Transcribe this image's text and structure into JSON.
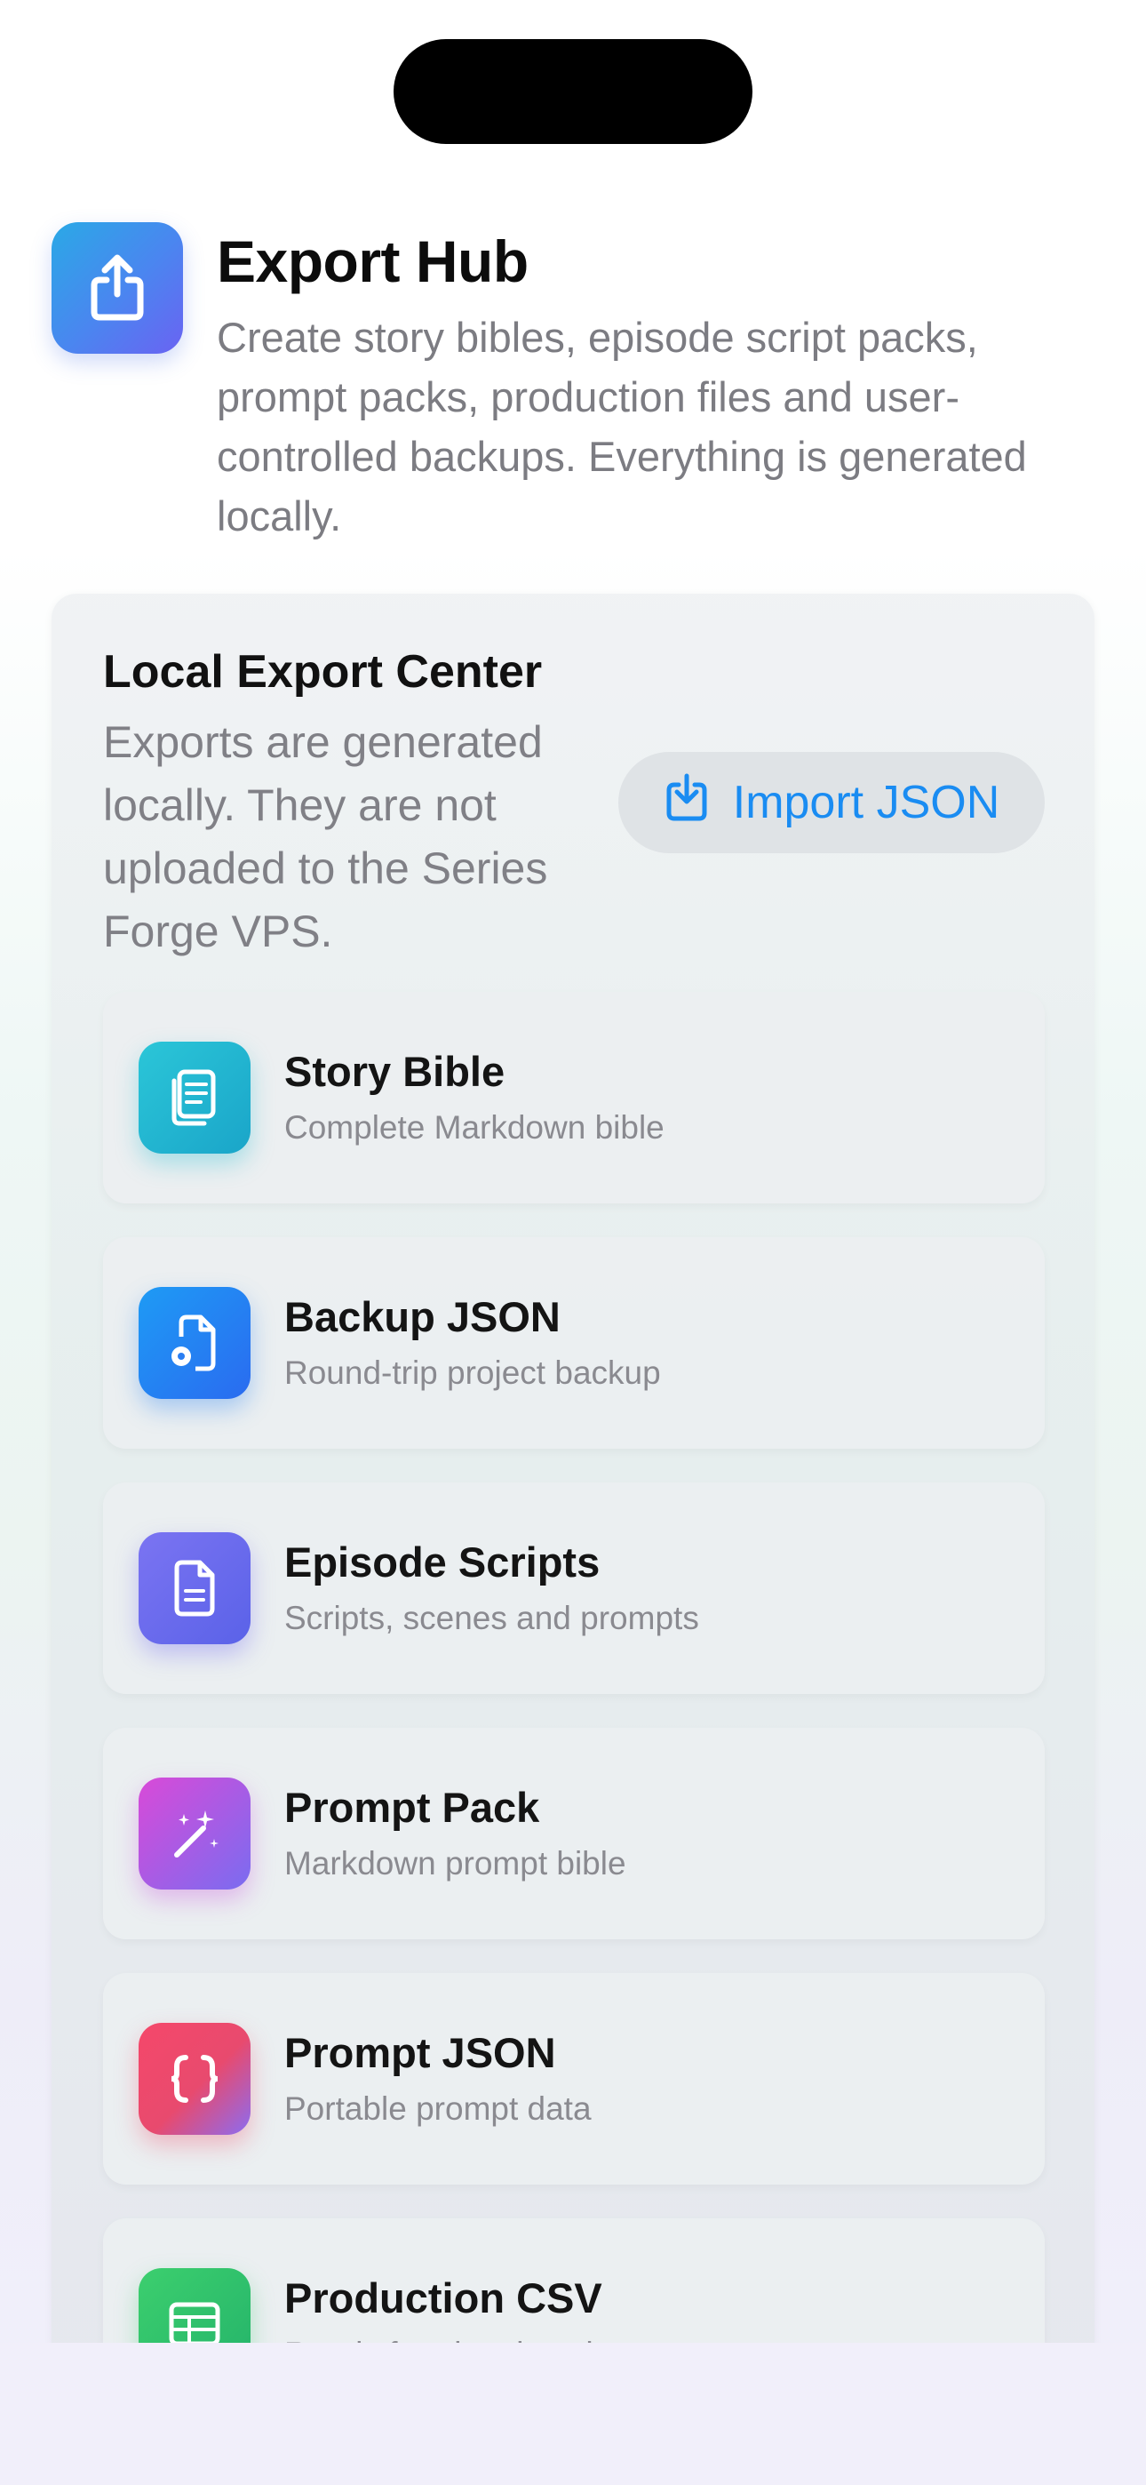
{
  "header": {
    "title": "Export Hub",
    "subtitle": "Create story bibles, episode script packs, prompt packs, production files and user-controlled backups. Everything is generated locally.",
    "icon": "share-icon"
  },
  "panel": {
    "title": "Local Export Center",
    "description": "Exports are generated locally. They are not uploaded to the Series Forge VPS.",
    "import_label": "Import JSON",
    "import_icon": "download-tray-icon"
  },
  "exports": [
    {
      "title": "Story Bible",
      "subtitle": "Complete Markdown bible",
      "icon": "book-pages-icon",
      "colors": [
        "#2bc6d8",
        "#1aa5c9"
      ]
    },
    {
      "title": "Backup JSON",
      "subtitle": "Round-trip project backup",
      "icon": "document-gear-icon",
      "colors": [
        "#1e9bf5",
        "#2a6bf0"
      ]
    },
    {
      "title": "Episode Scripts",
      "subtitle": "Scripts, scenes and prompts",
      "icon": "document-lines-icon",
      "colors": [
        "#7b74f2",
        "#5a62e8"
      ]
    },
    {
      "title": "Prompt Pack",
      "subtitle": "Markdown prompt bible",
      "icon": "magic-wand-icon",
      "colors": [
        "#d94ad8",
        "#7a6cf0"
      ]
    },
    {
      "title": "Prompt JSON",
      "subtitle": "Portable prompt data",
      "icon": "braces-icon",
      "colors": [
        "#f5486a",
        "#8b6cf2"
      ]
    },
    {
      "title": "Production CSV",
      "subtitle": "Ready for planning sheets",
      "icon": "table-grid-icon",
      "colors": [
        "#3ccf6e",
        "#24b36a"
      ]
    }
  ]
}
